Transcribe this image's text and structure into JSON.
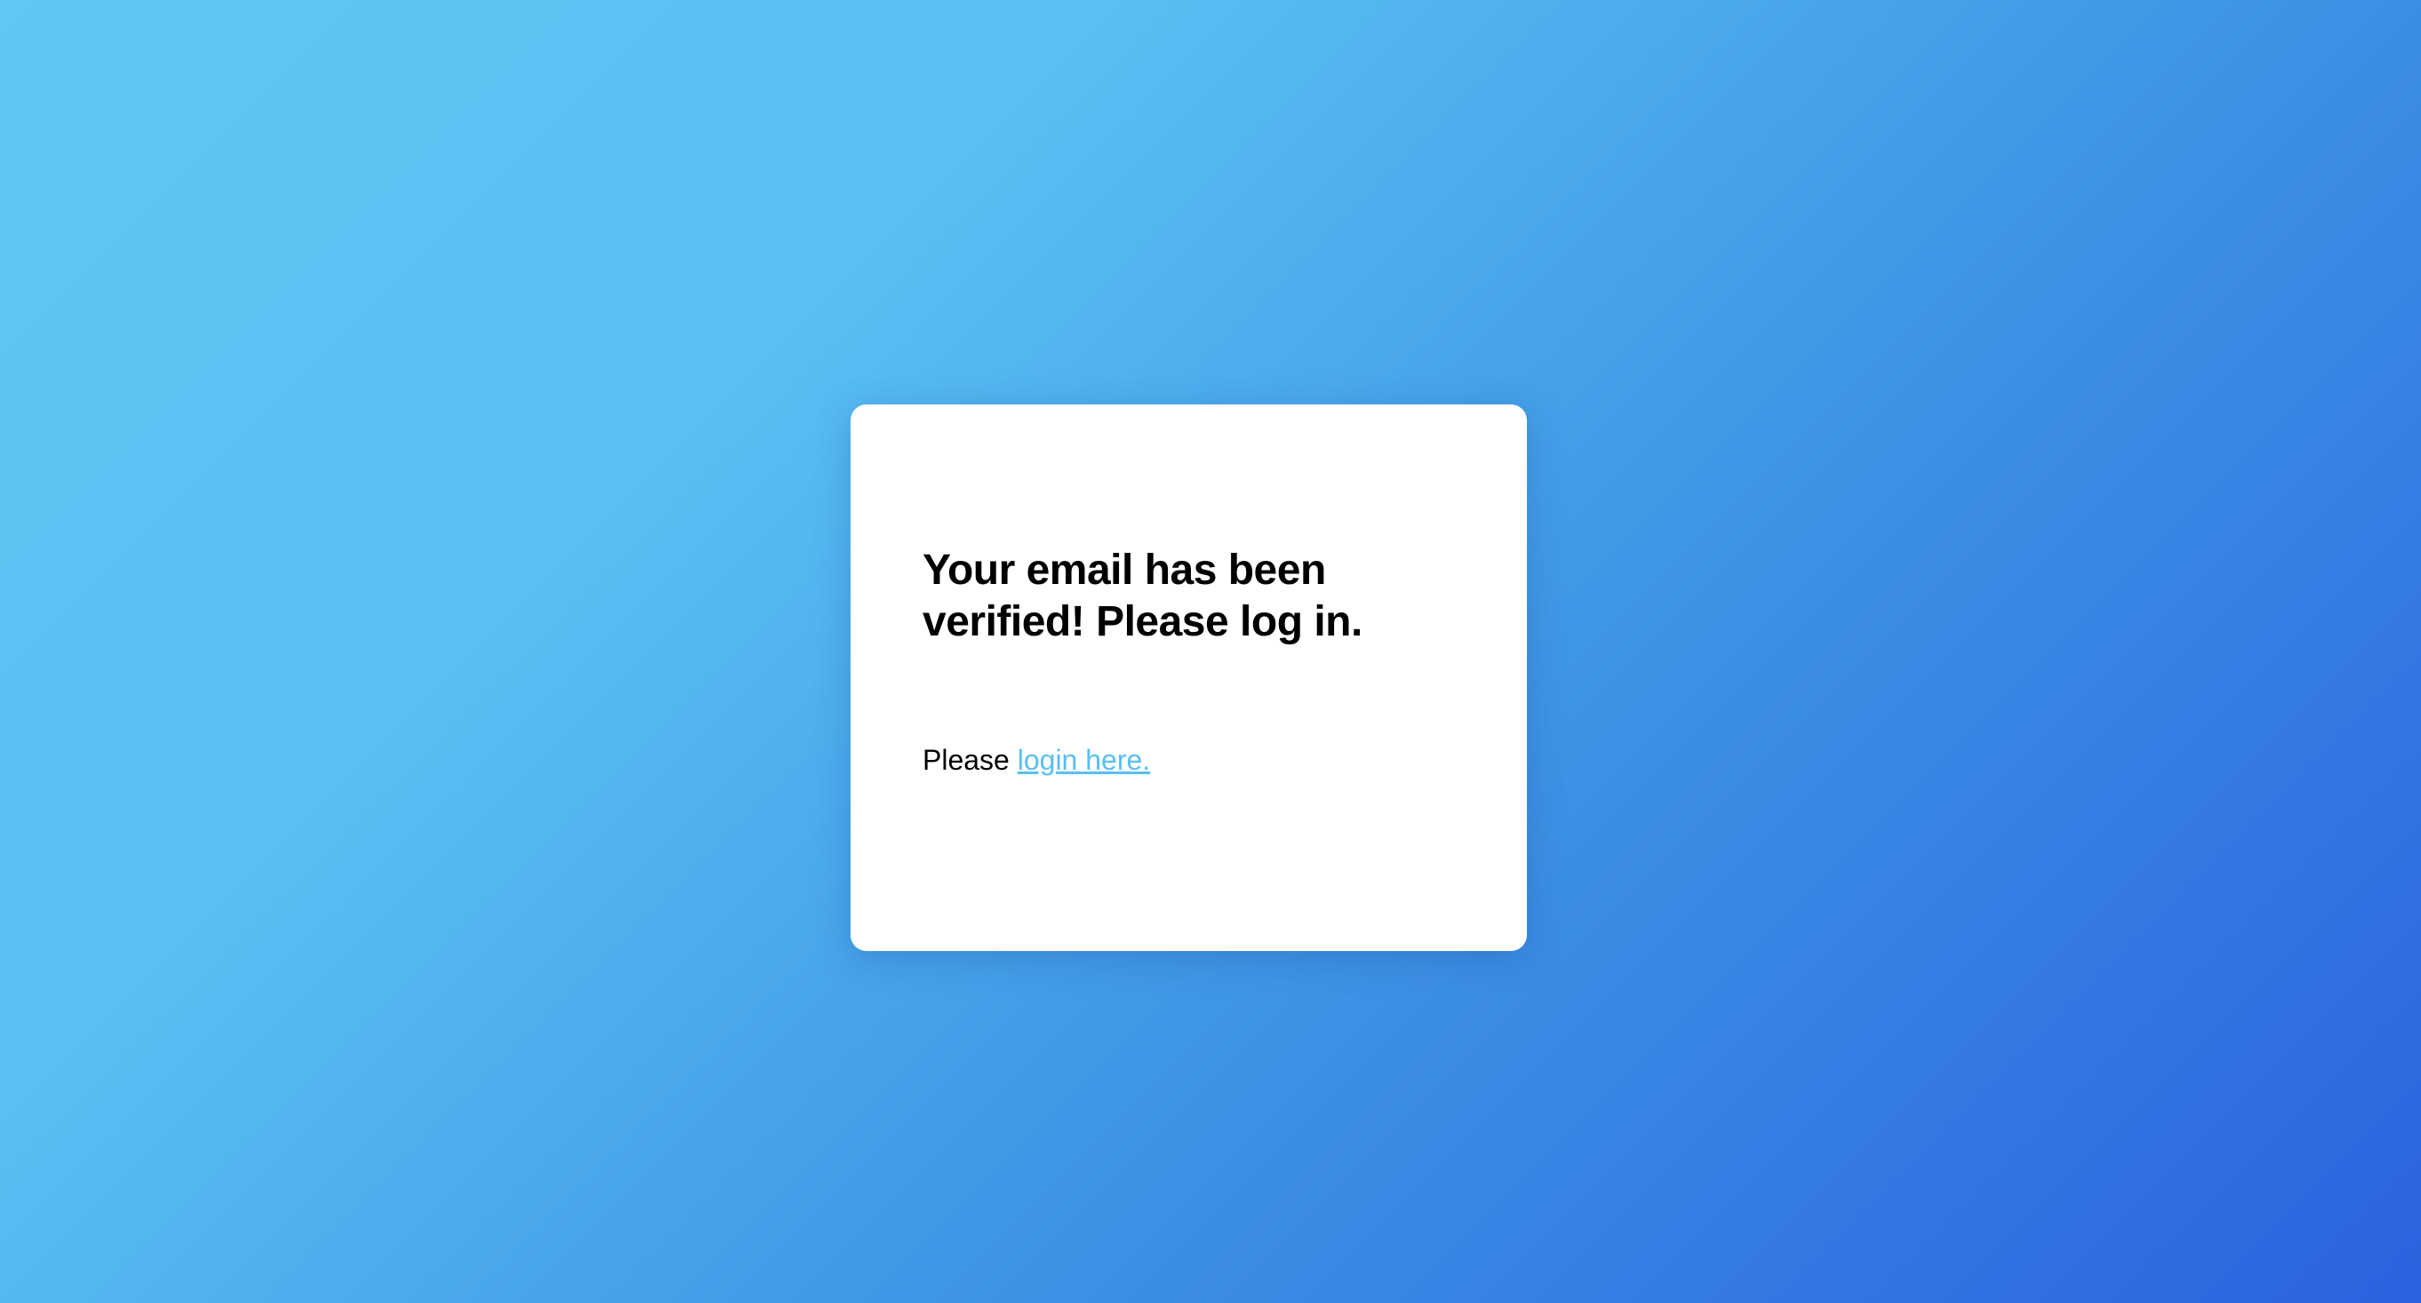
{
  "card": {
    "title": "Your email has been verified! Please log in.",
    "message_prefix": "Please",
    "login_link": "login here."
  },
  "colors": {
    "link": "#5bbef2",
    "gradient_start": "#5ec7f4",
    "gradient_end": "#2a62df"
  }
}
